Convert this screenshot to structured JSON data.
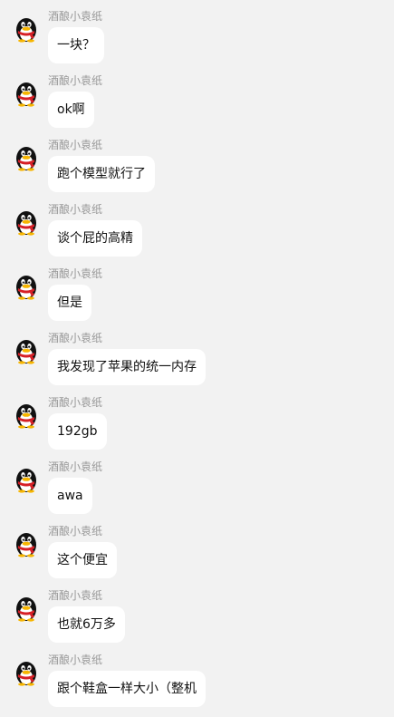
{
  "colors": {
    "background": "#f2f2f2",
    "bubble": "#ffffff",
    "sender_text": "#999999",
    "message_text": "#111111",
    "avatar_red_scarf": "#d61f26"
  },
  "messages": [
    {
      "sender": "酒酿小袁纸",
      "text": "一块？",
      "avatar_icon": "qq-penguin-icon"
    },
    {
      "sender": "酒酿小袁纸",
      "text": "ok啊",
      "avatar_icon": "qq-penguin-icon"
    },
    {
      "sender": "酒酿小袁纸",
      "text": "跑个模型就行了",
      "avatar_icon": "qq-penguin-icon"
    },
    {
      "sender": "酒酿小袁纸",
      "text": "谈个屁的高精",
      "avatar_icon": "qq-penguin-icon"
    },
    {
      "sender": "酒酿小袁纸",
      "text": "但是",
      "avatar_icon": "qq-penguin-icon"
    },
    {
      "sender": "酒酿小袁纸",
      "text": "我发现了苹果的统一内存",
      "avatar_icon": "qq-penguin-icon"
    },
    {
      "sender": "酒酿小袁纸",
      "text": "192gb",
      "avatar_icon": "qq-penguin-icon"
    },
    {
      "sender": "酒酿小袁纸",
      "text": "awa",
      "avatar_icon": "qq-penguin-icon"
    },
    {
      "sender": "酒酿小袁纸",
      "text": "这个便宜",
      "avatar_icon": "qq-penguin-icon"
    },
    {
      "sender": "酒酿小袁纸",
      "text": "也就6万多",
      "avatar_icon": "qq-penguin-icon"
    },
    {
      "sender": "酒酿小袁纸",
      "text": "跟个鞋盒一样大小（整机",
      "avatar_icon": "qq-penguin-icon"
    }
  ]
}
